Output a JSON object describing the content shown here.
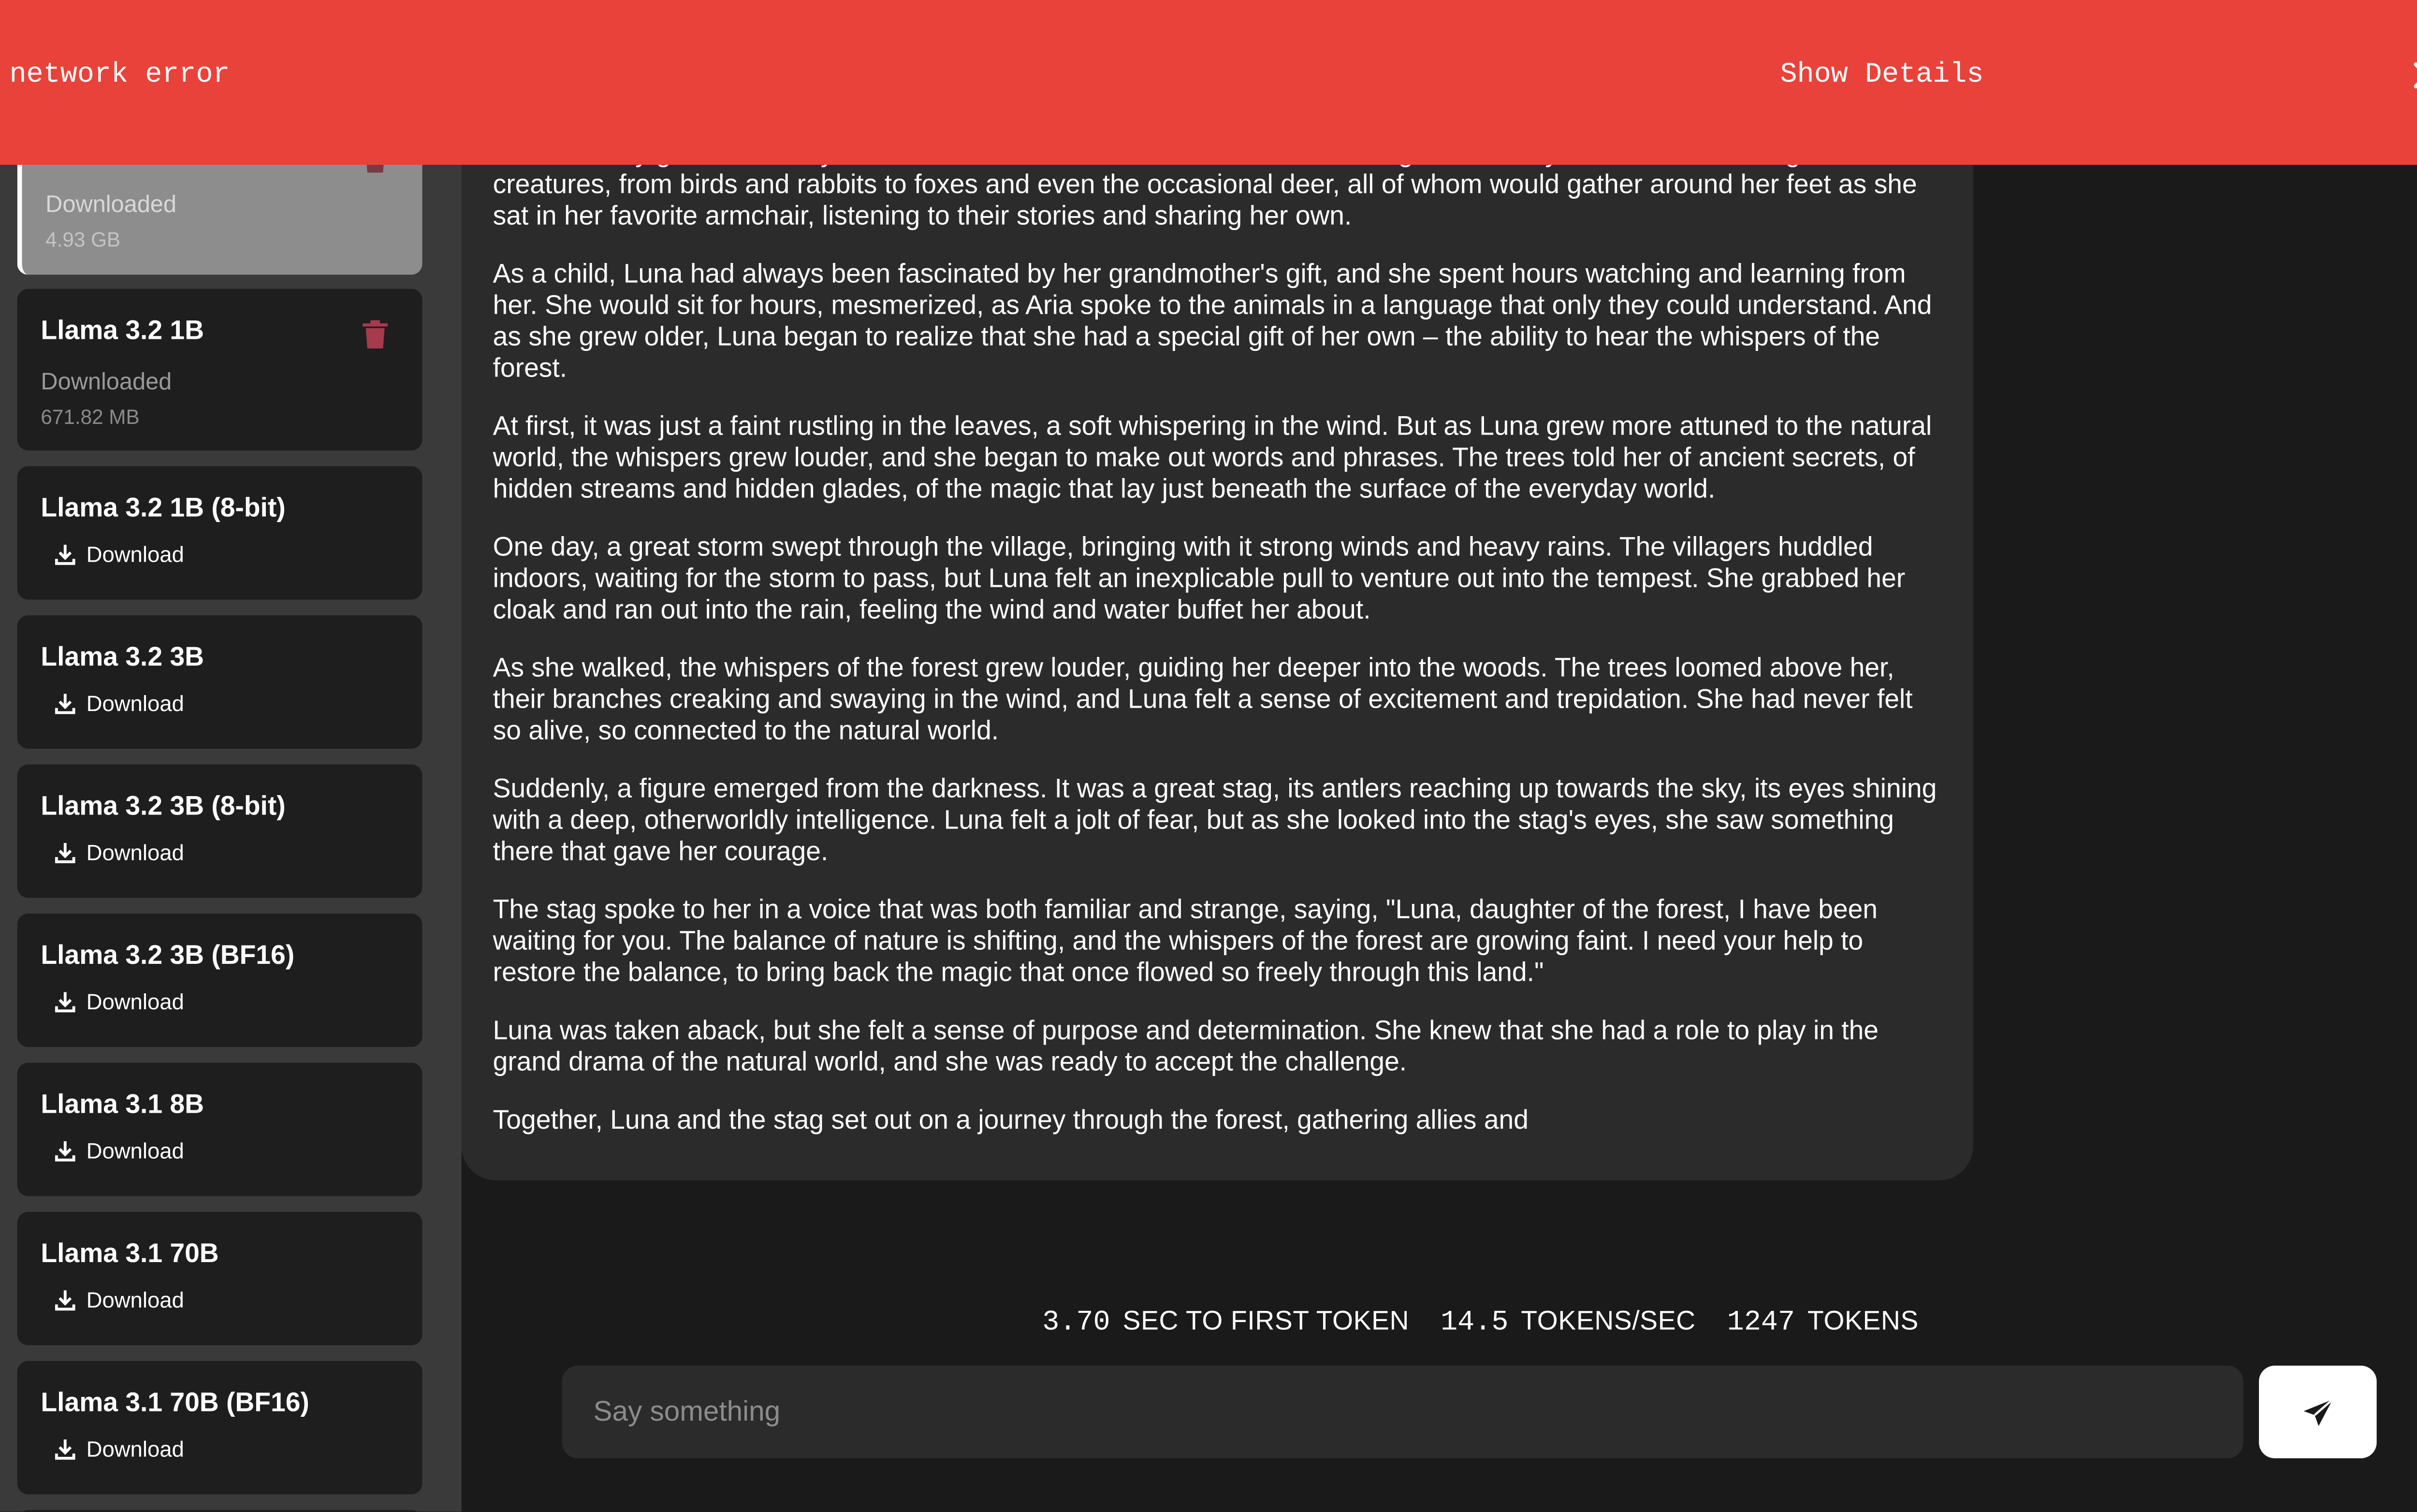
{
  "error_banner": {
    "message": "network error",
    "details_label": "Show Details",
    "close_icon": "close-icon",
    "color": "#e9423a"
  },
  "sidebar": {
    "models": [
      {
        "name": "",
        "status": "Downloaded",
        "size": "4.93 GB",
        "selected": true,
        "action": "delete"
      },
      {
        "name": "Llama 3.2 1B",
        "status": "Downloaded",
        "size": "671.82 MB",
        "action": "delete"
      },
      {
        "name": "Llama 3.2 1B (8-bit)",
        "download_label": "Download",
        "action": "download"
      },
      {
        "name": "Llama 3.2 3B",
        "download_label": "Download",
        "action": "download"
      },
      {
        "name": "Llama 3.2 3B (8-bit)",
        "download_label": "Download",
        "action": "download"
      },
      {
        "name": "Llama 3.2 3B (BF16)",
        "download_label": "Download",
        "action": "download"
      },
      {
        "name": "Llama 3.1 8B",
        "download_label": "Download",
        "action": "download"
      },
      {
        "name": "Llama 3.1 70B",
        "download_label": "Download",
        "action": "download"
      },
      {
        "name": "Llama 3.1 70B (BF16)",
        "download_label": "Download",
        "action": "download"
      }
    ]
  },
  "chat": {
    "paragraphs": [
      "extraordinary gift – the ability to communicate with animals. Aria's small cottage was always filled with a menagerie of creatures, from birds and rabbits to foxes and even the occasional deer, all of whom would gather around her feet as she sat in her favorite armchair, listening to their stories and sharing her own.",
      "As a child, Luna had always been fascinated by her grandmother's gift, and she spent hours watching and learning from her. She would sit for hours, mesmerized, as Aria spoke to the animals in a language that only they could understand. And as she grew older, Luna began to realize that she had a special gift of her own – the ability to hear the whispers of the forest.",
      "At first, it was just a faint rustling in the leaves, a soft whispering in the wind. But as Luna grew more attuned to the natural world, the whispers grew louder, and she began to make out words and phrases. The trees told her of ancient secrets, of hidden streams and hidden glades, of the magic that lay just beneath the surface of the everyday world.",
      "One day, a great storm swept through the village, bringing with it strong winds and heavy rains. The villagers huddled indoors, waiting for the storm to pass, but Luna felt an inexplicable pull to venture out into the tempest. She grabbed her cloak and ran out into the rain, feeling the wind and water buffet her about.",
      "As she walked, the whispers of the forest grew louder, guiding her deeper into the woods. The trees loomed above her, their branches creaking and swaying in the wind, and Luna felt a sense of excitement and trepidation. She had never felt so alive, so connected to the natural world.",
      "Suddenly, a figure emerged from the darkness. It was a great stag, its antlers reaching up towards the sky, its eyes shining with a deep, otherworldly intelligence. Luna felt a jolt of fear, but as she looked into the stag's eyes, she saw something there that gave her courage.",
      "The stag spoke to her in a voice that was both familiar and strange, saying, \"Luna, daughter of the forest, I have been waiting for you. The balance of nature is shifting, and the whispers of the forest are growing faint. I need your help to restore the balance, to bring back the magic that once flowed so freely through this land.\"",
      "Luna was taken aback, but she felt a sense of purpose and determination. She knew that she had a role to play in the grand drama of the natural world, and she was ready to accept the challenge.",
      "Together, Luna and the stag set out on a journey through the forest, gathering allies and"
    ]
  },
  "stats": {
    "first_token_value": "3.70",
    "first_token_label": "SEC TO FIRST TOKEN",
    "tps_value": "14.5",
    "tps_label": "TOKENS/SEC",
    "tokens_value": "1247",
    "tokens_label": "TOKENS"
  },
  "input": {
    "placeholder": "Say something",
    "value": ""
  },
  "send_button": {
    "icon": "send-icon"
  }
}
